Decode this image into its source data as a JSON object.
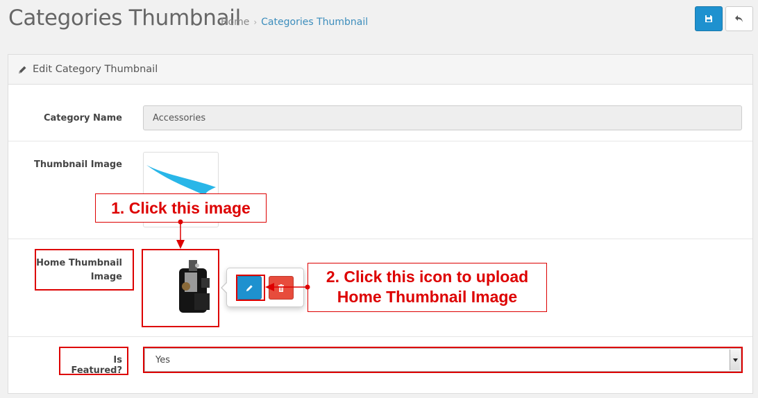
{
  "header": {
    "title": "Categories Thumbnail",
    "breadcrumb": {
      "home": "Home",
      "separator": "›",
      "current": "Categories Thumbnail"
    }
  },
  "toolbar": {
    "save_icon": "save-icon",
    "back_icon": "reply-icon",
    "save_color": "#1e91cf"
  },
  "panel": {
    "heading": "Edit Category Thumbnail",
    "heading_icon": "pencil-icon",
    "fields": {
      "category_name": {
        "label": "Category Name",
        "value": "Accessories"
      },
      "thumbnail_image": {
        "label": "Thumbnail Image"
      },
      "home_thumbnail_image": {
        "label": "Home Thumbnail Image",
        "label_line1": "Home Thumbnail",
        "label_line2": "Image"
      },
      "is_featured": {
        "label": "Is Featured?",
        "selected": "Yes"
      }
    }
  },
  "popover": {
    "edit_icon": "pencil-icon",
    "delete_icon": "trash-icon",
    "edit_color": "#1e91cf",
    "delete_color": "#e74c3c"
  },
  "annotations": {
    "step1": "1. Click this image",
    "step2_line1": "2. Click this icon to upload",
    "step2_line2": "Home Thumbnail Image",
    "color": "#dd0000"
  }
}
